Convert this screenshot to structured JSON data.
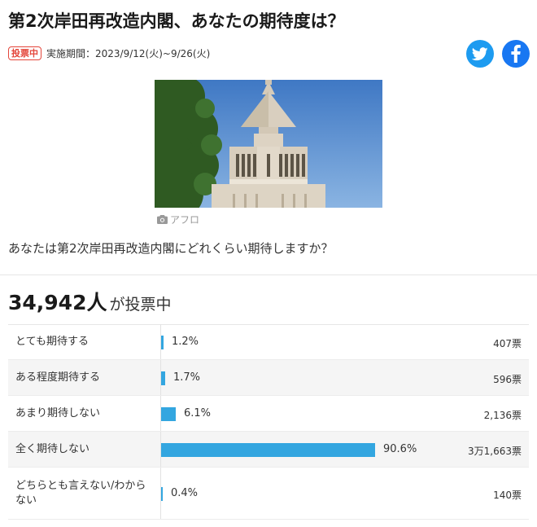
{
  "title": "第2次岸田再改造内閣、あなたの期待度は？",
  "status_badge": "投票中",
  "period": "実施期間：2023/9/12(火)~9/26(火)",
  "share": {
    "twitter_icon": "twitter-bird-icon",
    "facebook_icon": "facebook-f-icon"
  },
  "photo": {
    "credit": "アフロ",
    "camera_icon": "camera-icon"
  },
  "question": "あなたは第2次岸田再改造内閣にどれくらい期待しますか？",
  "total_votes": {
    "number": "34,942人",
    "suffix": "が投票中"
  },
  "bar_color": "#33a6e0",
  "options": [
    {
      "label": "とても期待する",
      "percent_text": "1.2%",
      "percent": 1.2,
      "count": "407票"
    },
    {
      "label": "ある程度期待する",
      "percent_text": "1.7%",
      "percent": 1.7,
      "count": "596票"
    },
    {
      "label": "あまり期待しない",
      "percent_text": "6.1%",
      "percent": 6.1,
      "count": "2,136票"
    },
    {
      "label": "全く期待しない",
      "percent_text": "90.6%",
      "percent": 90.6,
      "count": "3万1,663票"
    },
    {
      "label": "どちらとも言えない/わからない",
      "percent_text": "0.4%",
      "percent": 0.4,
      "count": "140票"
    }
  ]
}
